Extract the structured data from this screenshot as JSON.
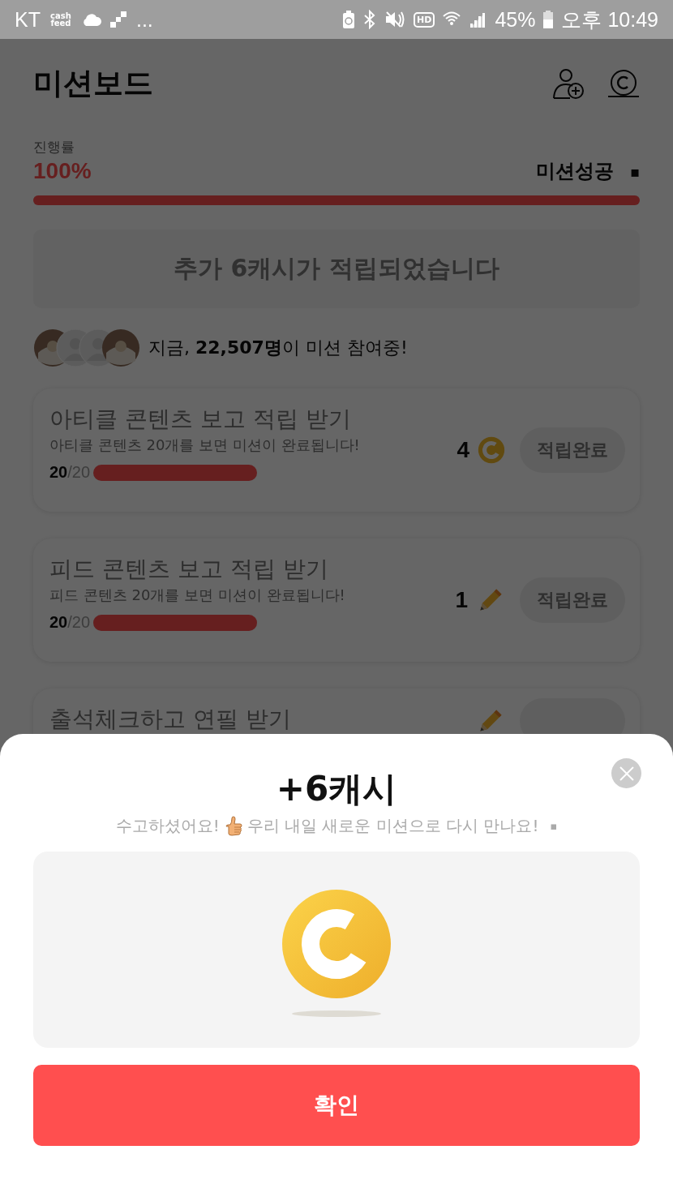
{
  "status_bar": {
    "carrier": "KT",
    "app_logo": "cash feed",
    "more": "...",
    "hd": "HD",
    "battery": "45%",
    "time": "오후 10:49"
  },
  "header": {
    "title": "미션보드"
  },
  "progress": {
    "label": "진행률",
    "percent": "100%",
    "result": "미션성공",
    "result_mark": "▪",
    "level": 1
  },
  "banner": {
    "text": "추가 6캐시가 적립되었습니다"
  },
  "participants": {
    "avatars": [
      {
        "kind": "photo"
      },
      {
        "kind": "silhouette"
      },
      {
        "kind": "silhouette"
      },
      {
        "kind": "photo"
      }
    ],
    "text": "지금, **22,507명**이 미션 참여중!"
  },
  "missions": [
    {
      "title": "아티클 콘텐츠 보고 적립 받기",
      "description": "아티클 콘텐츠 20개를 보면 미션이 완료됩니다!",
      "done": "20",
      "total": "/20",
      "level": 1,
      "reward": "4",
      "kind": "coin",
      "button": "적립완료"
    },
    {
      "title": "피드 콘텐츠 보고 적립 받기",
      "description": "피드 콘텐츠 20개를 보면 미션이 완료됩니다!",
      "done": "20",
      "total": "/20",
      "level": 1,
      "reward": "1",
      "kind": "pencil",
      "button": "적립완료"
    },
    {
      "title": "출석체크하고 연필 받기",
      "kind": "pencil"
    }
  ],
  "sheet": {
    "title": "+6캐시",
    "message_start": "수고하셨어요!",
    "message_end": "우리 내일 새로운 미션으로 다시 만나요!",
    "message_mark": "▪",
    "confirm": "확인"
  }
}
